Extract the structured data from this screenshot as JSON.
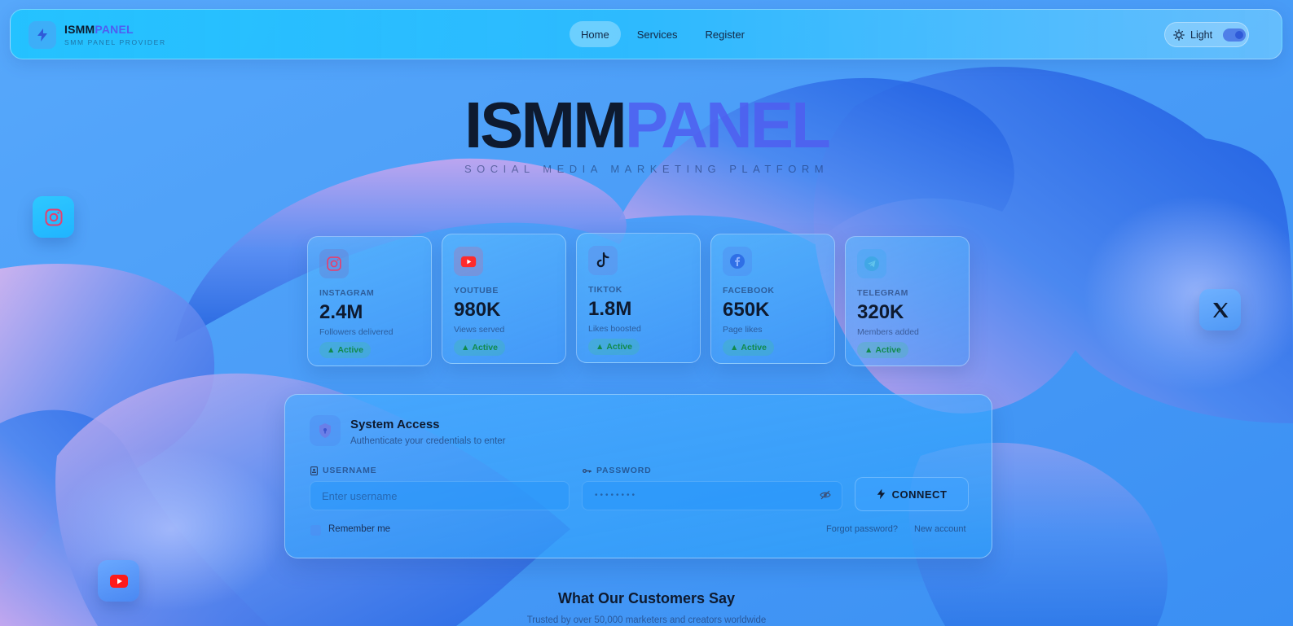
{
  "header": {
    "brand_part1": "ISMM",
    "brand_part2": "PANEL",
    "brand_sub": "SMM PANEL PROVIDER",
    "logo_icon": "bolt-icon",
    "nav": [
      {
        "label": "Home",
        "active": true
      },
      {
        "label": "Services",
        "active": false
      },
      {
        "label": "Register",
        "active": false
      }
    ],
    "theme_label": "Light",
    "theme_icon": "sun-icon"
  },
  "hero": {
    "title_part1": "ISMM",
    "title_part2": "PANEL",
    "subtitle": "SOCIAL MEDIA MARKETING PLATFORM"
  },
  "floating_icons": [
    "instagram-icon",
    "x-icon",
    "youtube-icon"
  ],
  "stats": [
    {
      "platform": "INSTAGRAM",
      "value": "2.4M",
      "desc": "Followers delivered",
      "status": "Active",
      "icon": "instagram-icon",
      "color": "#e4406f"
    },
    {
      "platform": "YOUTUBE",
      "value": "980K",
      "desc": "Views served",
      "status": "Active",
      "icon": "youtube-icon",
      "color": "#ff2b2b"
    },
    {
      "platform": "TIKTOK",
      "value": "1.8M",
      "desc": "Likes boosted",
      "status": "Active",
      "icon": "tiktok-icon",
      "color": "#0e1a2f"
    },
    {
      "platform": "FACEBOOK",
      "value": "650K",
      "desc": "Page likes",
      "status": "Active",
      "icon": "facebook-icon",
      "color": "#2f6fe6"
    },
    {
      "platform": "TELEGRAM",
      "value": "320K",
      "desc": "Members added",
      "status": "Active",
      "icon": "telegram-icon",
      "color": "#2fa8d8"
    }
  ],
  "login": {
    "title": "System Access",
    "subtitle": "Authenticate your credentials to enter",
    "username_label": "USERNAME",
    "username_placeholder": "Enter username",
    "password_label": "PASSWORD",
    "password_mask": "••••••••",
    "connect_label": "CONNECT",
    "remember_label": "Remember me",
    "forgot_label": "Forgot password?",
    "new_account_label": "New account"
  },
  "testimonials": {
    "title": "What Our Customers Say",
    "subtitle": "Trusted by over 50,000 marketers and creators worldwide"
  },
  "colors": {
    "accent": "#4f5ef0",
    "active_green": "#118a4c",
    "header_bg": "#22c3ff"
  }
}
